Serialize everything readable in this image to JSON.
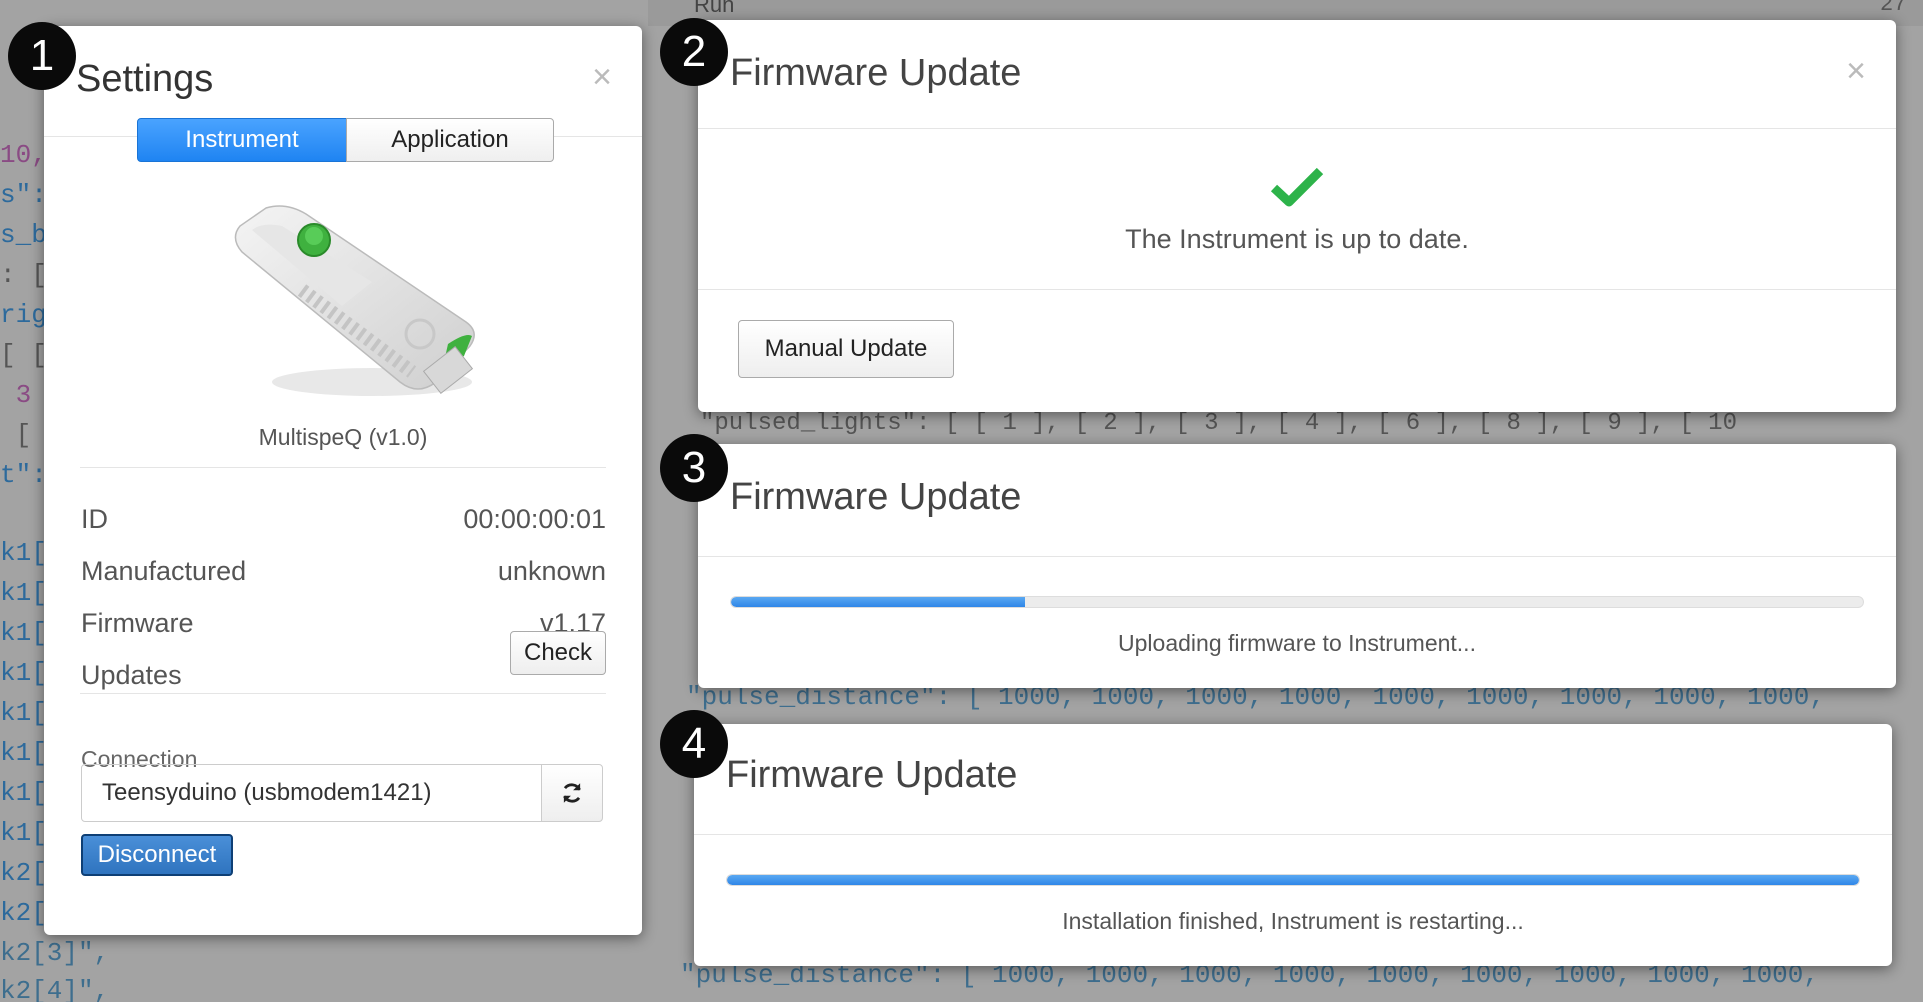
{
  "markers": [
    "1",
    "2",
    "3",
    "4"
  ],
  "settings": {
    "title": "Settings",
    "close_icon": "close-icon",
    "tabs": [
      {
        "label": "Instrument",
        "active": true
      },
      {
        "label": "Application",
        "active": false
      }
    ],
    "device_name": "MultispeQ (v1.0)",
    "rows": [
      {
        "label": "ID",
        "value": "00:00:00:01"
      },
      {
        "label": "Manufactured",
        "value": "unknown"
      },
      {
        "label": "Firmware",
        "value": "v1.17"
      },
      {
        "label": "Updates",
        "button": "Check"
      }
    ],
    "connection": {
      "label": "Connection",
      "value": "Teensyduino (usbmodem1421)",
      "refresh_icon": "refresh-icon",
      "disconnect_label": "Disconnect"
    }
  },
  "fw_up_to_date": {
    "title": "Firmware Update",
    "status_icon": "checkmark-icon",
    "message": "The Instrument is up to date.",
    "button": "Manual Update",
    "accent_color": "#2db34a"
  },
  "fw_uploading": {
    "title": "Firmware Update",
    "progress": 0.26,
    "message": "Uploading firmware to Instrument..."
  },
  "fw_finished": {
    "title": "Firmware Update",
    "progress": 1.0,
    "message": "Installation finished, Instrument is restarting..."
  },
  "background_code": {
    "lines": [
      "10,",
      "s\":",
      "s_b",
      ": [",
      "rig",
      "[ [",
      " 3",
      " [",
      "t\":",
      "k1[",
      "k1[",
      "k1[",
      "k1[",
      "k1[",
      "k1[",
      "k1[",
      "k1[",
      "k2[",
      "k2[",
      "k2[3]\",",
      "k2[4]\","
    ],
    "top_label": "Run",
    "top_right": "27",
    "mid_text_1": "\"pulsed_lights\": [ [ 1 ], [ 2 ], [ 3 ], [ 4 ], [ 6 ], [ 8 ], [ 9 ], [ 10",
    "mid_text_2": "\"pulse_distance\": [ 1000, 1000, 1000, 1000, 1000, 1000, 1000, 1000, 1000,",
    "mid_text_3": "\"pulse_distance\": [ 1000, 1000, 1000, 1000, 1000, 1000, 1000, 1000, 1000,"
  },
  "colors": {
    "primary": "#1f84f2",
    "success": "#2db34a",
    "disconnect": "#2f74bf"
  }
}
